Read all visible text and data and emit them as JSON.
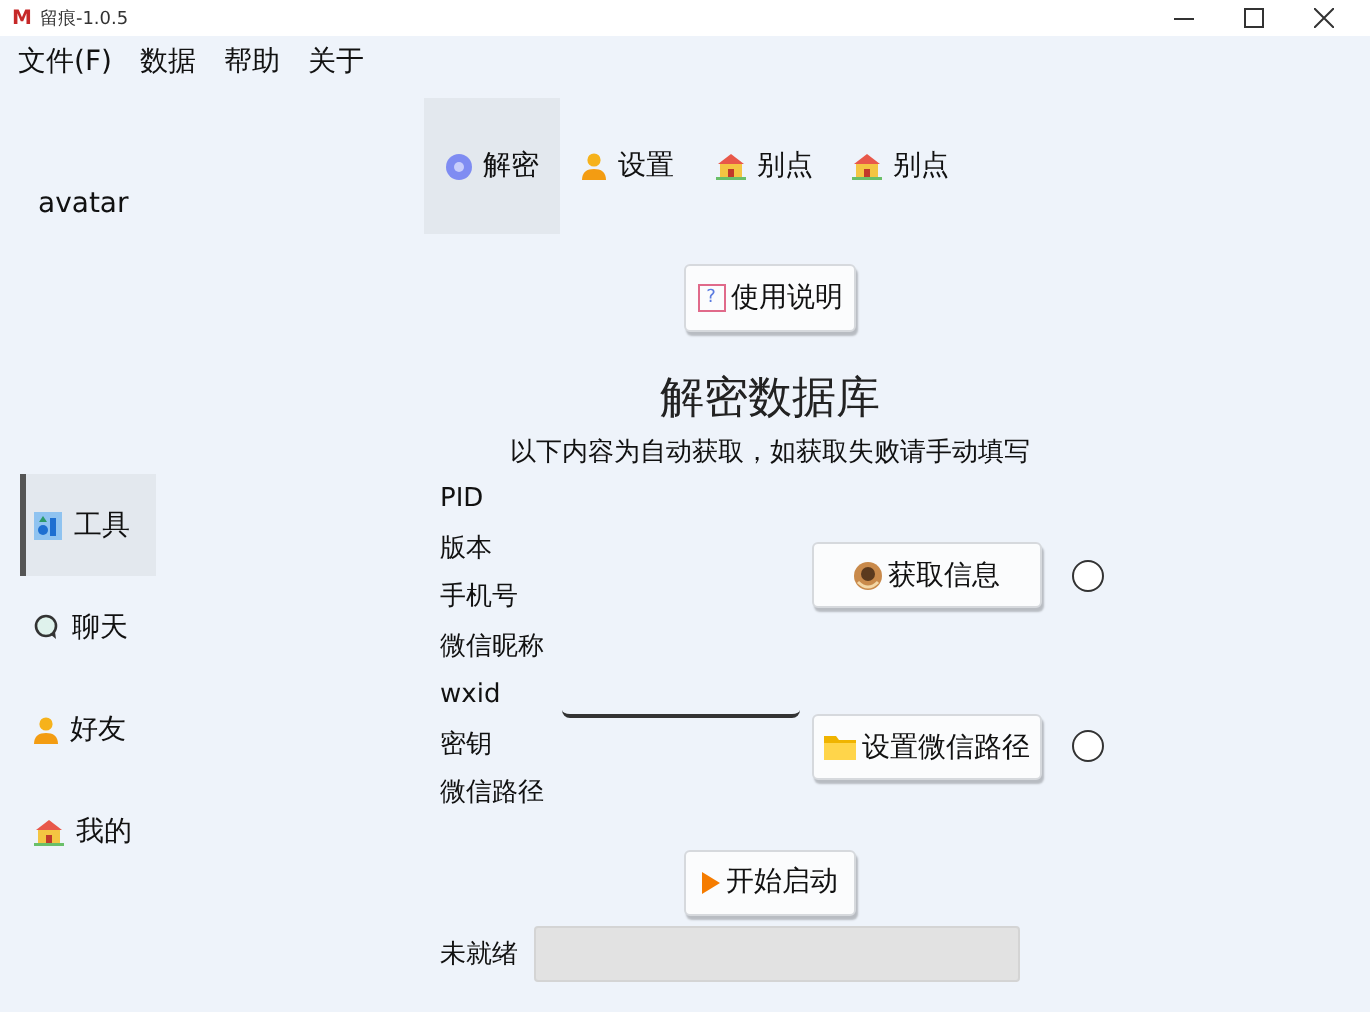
{
  "window": {
    "app_icon": "M",
    "title": "留痕-1.0.5"
  },
  "menu": [
    "文件(F)",
    "数据",
    "帮助",
    "关于"
  ],
  "sidebar": {
    "avatar": "avatar",
    "items": [
      {
        "label": "工具",
        "selected": true
      },
      {
        "label": "聊天",
        "selected": false
      },
      {
        "label": "好友",
        "selected": false
      },
      {
        "label": "我的",
        "selected": false
      }
    ]
  },
  "tabs": [
    {
      "label": "解密",
      "selected": true
    },
    {
      "label": "设置",
      "selected": false
    },
    {
      "label": "别点",
      "selected": false
    },
    {
      "label": "别点",
      "selected": false
    }
  ],
  "help_button": {
    "icon_text": "?",
    "label": "使用说明"
  },
  "heading": "解密数据库",
  "subheading": "以下内容为自动获取，如获取失败请手动填写",
  "fields": [
    "PID",
    "版本",
    "手机号",
    "微信昵称",
    "wxid",
    "密钥",
    "微信路径"
  ],
  "actions": [
    {
      "label": "获取信息",
      "checked": false
    },
    {
      "label": "设置微信路径",
      "checked": false
    }
  ],
  "start_button": {
    "label": "开始启动"
  },
  "status": {
    "label": "未就绪"
  }
}
